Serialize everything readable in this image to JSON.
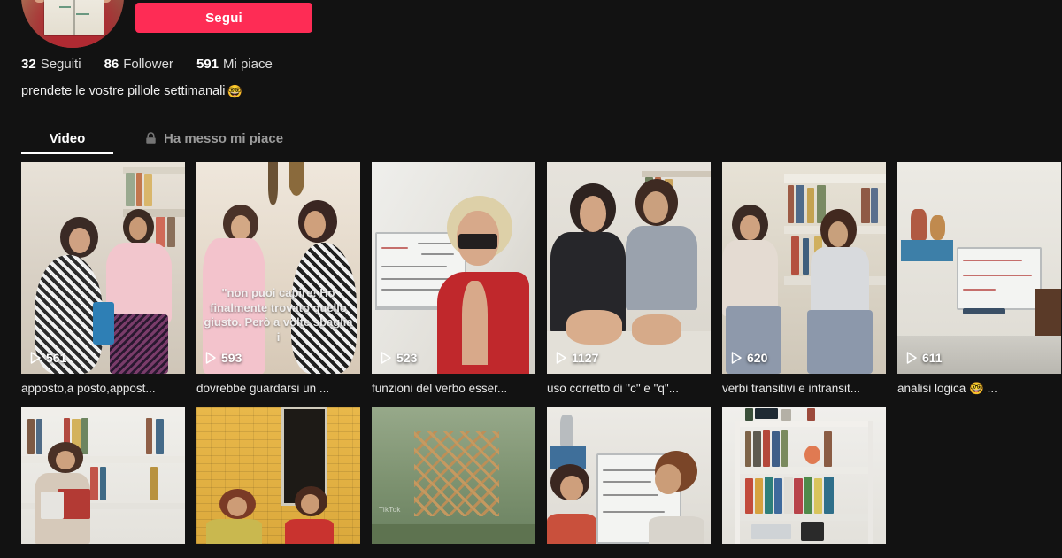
{
  "theme": {
    "background": "#121212",
    "accent": "#FE2C55",
    "text_primary": "#ffffff",
    "text_secondary": "#9b9b9b"
  },
  "profile": {
    "avatar_alt": "person-holding-open-book",
    "follow_button_label": "Segui",
    "stats": [
      {
        "name": "following",
        "count": "32",
        "label": "Seguiti"
      },
      {
        "name": "followers",
        "count": "86",
        "label": "Follower"
      },
      {
        "name": "likes",
        "count": "591",
        "label": "Mi piace"
      }
    ],
    "bio_text": "prendete le vostre pillole settimanali",
    "bio_emoji": "🤓"
  },
  "tabs": [
    {
      "id": "video",
      "label": "Video",
      "active": true,
      "locked": false
    },
    {
      "id": "liked",
      "label": "Ha messo mi piace",
      "active": false,
      "locked": true,
      "lock_icon": "lock-icon"
    }
  ],
  "videos": [
    {
      "views": "561",
      "caption": "apposto,a posto,appost...",
      "overlay_text": "",
      "scene": "two-girls-bedroom-phone"
    },
    {
      "views": "593",
      "caption": "dovrebbe guardarsi un ...",
      "overlay_text": "\"non puoi capire! Ho finalmente trovato quello giusto. Però a volte sbaglia i",
      "scene": "two-girls-pink-hoodie-talking"
    },
    {
      "views": "523",
      "caption": "funzioni del verbo esser...",
      "overlay_text": "",
      "scene": "blonde-woman-red-dress-whiteboard"
    },
    {
      "views": "1127",
      "caption": "uso corretto di \"c\" e \"q\"...",
      "overlay_text": "",
      "scene": "two-girls-studying-desk"
    },
    {
      "views": "620",
      "caption": "verbi transitivi e intransit...",
      "overlay_text": "",
      "scene": "two-girls-floor-bookshelf"
    },
    {
      "views": "611",
      "caption": "analisi logica 🤓 ...",
      "overlay_text": "",
      "scene": "whiteboard-room-alle-6-di-inverno"
    }
  ],
  "videos_row2": [
    {
      "scene": "girl-reading-book-bookshelf"
    },
    {
      "scene": "two-girls-yellow-brick-wall"
    },
    {
      "scene": "garden-lattice-trees",
      "watermark": "TikTok"
    },
    {
      "scene": "two-girls-whiteboard-profile"
    },
    {
      "scene": "bookshelf-colorful-books"
    },
    {
      "scene": "empty"
    }
  ],
  "icons": {
    "play": "play-icon",
    "lock": "lock-icon"
  }
}
